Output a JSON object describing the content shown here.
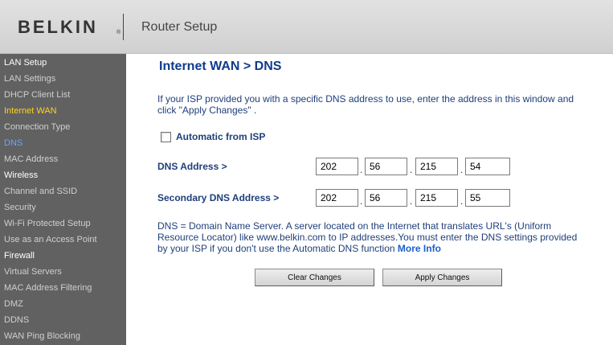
{
  "header": {
    "logo_text": "BELKIN",
    "logo_reg": "®",
    "title": "Router Setup"
  },
  "sidebar": {
    "items": [
      {
        "label": "LAN Setup",
        "kind": "section"
      },
      {
        "label": "LAN Settings",
        "kind": "link"
      },
      {
        "label": "DHCP Client List",
        "kind": "link"
      },
      {
        "label": "Internet WAN",
        "kind": "active-section"
      },
      {
        "label": "Connection Type",
        "kind": "link"
      },
      {
        "label": "DNS",
        "kind": "active"
      },
      {
        "label": "MAC Address",
        "kind": "link"
      },
      {
        "label": "Wireless",
        "kind": "section"
      },
      {
        "label": "Channel and SSID",
        "kind": "link"
      },
      {
        "label": "Security",
        "kind": "link"
      },
      {
        "label": "Wi-Fi Protected Setup",
        "kind": "link"
      },
      {
        "label": "Use as an Access Point",
        "kind": "link"
      },
      {
        "label": "Firewall",
        "kind": "section"
      },
      {
        "label": "Virtual Servers",
        "kind": "link"
      },
      {
        "label": "MAC Address Filtering",
        "kind": "link"
      },
      {
        "label": "DMZ",
        "kind": "link"
      },
      {
        "label": "DDNS",
        "kind": "link"
      },
      {
        "label": "WAN Ping Blocking",
        "kind": "link"
      }
    ]
  },
  "main": {
    "title": "Internet WAN > DNS",
    "intro_line1": "If your ISP provided you with a specific DNS address to use, enter the address in this window and",
    "intro_line2": "click \"Apply Changes\" .",
    "auto_label": "Automatic from ISP",
    "auto_checked": false,
    "dns_label": "DNS Address >",
    "dns_octets": [
      "202",
      "56",
      "215",
      "54"
    ],
    "secondary_label": "Secondary DNS Address >",
    "secondary_octets": [
      "202",
      "56",
      "215",
      "55"
    ],
    "note_line1": "DNS = Domain Name Server. A server located on the Internet that translates URL's (Uniform",
    "note_line2": "Resource Locator) like www.belkin.com to IP addresses.You must enter the DNS settings provided",
    "note_line3": "by your ISP if you don't use the Automatic DNS function",
    "more_info": "More Info",
    "clear_button": "Clear Changes",
    "apply_button": "Apply Changes"
  }
}
